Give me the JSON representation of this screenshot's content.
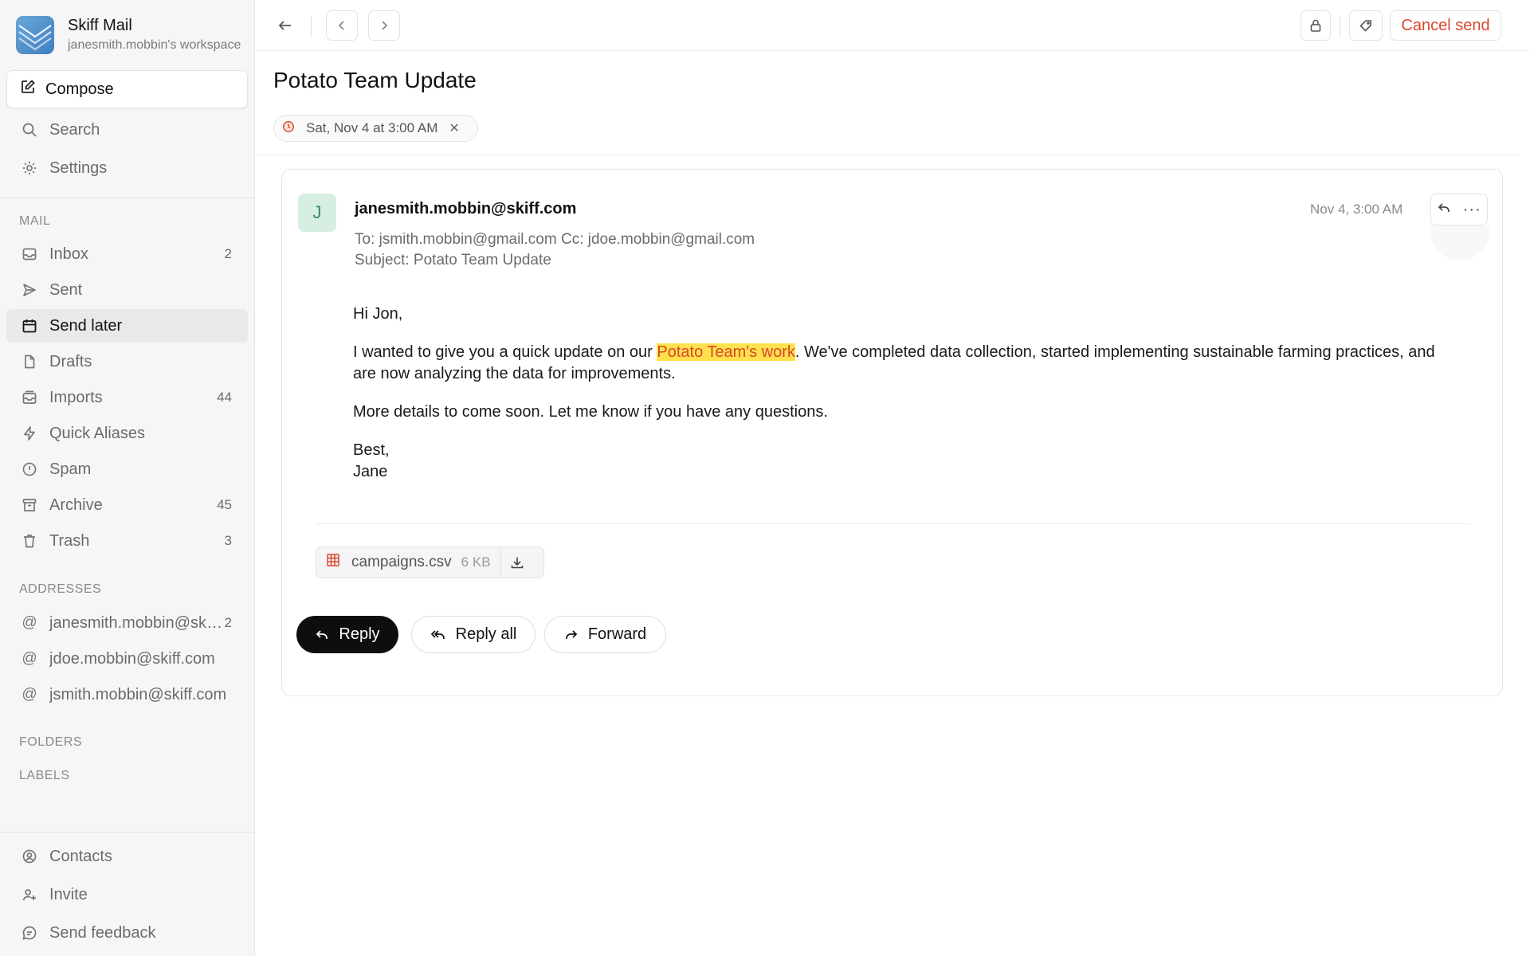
{
  "app": {
    "title": "Skiff Mail",
    "workspace": "janesmith.mobbin's workspace"
  },
  "sidebar": {
    "compose_label": "Compose",
    "search_label": "Search",
    "settings_label": "Settings",
    "mail_section": "MAIL",
    "mail_items": [
      {
        "label": "Inbox",
        "count": "2",
        "icon": "inbox-icon"
      },
      {
        "label": "Sent",
        "count": "",
        "icon": "send-icon"
      },
      {
        "label": "Send later",
        "count": "",
        "icon": "calendar-icon"
      },
      {
        "label": "Drafts",
        "count": "",
        "icon": "file-icon"
      },
      {
        "label": "Imports",
        "count": "44",
        "icon": "imports-icon"
      },
      {
        "label": "Quick Aliases",
        "count": "",
        "icon": "bolt-icon"
      },
      {
        "label": "Spam",
        "count": "",
        "icon": "alert-icon"
      },
      {
        "label": "Archive",
        "count": "45",
        "icon": "archive-icon"
      },
      {
        "label": "Trash",
        "count": "3",
        "icon": "trash-icon"
      }
    ],
    "active_item": "Send later",
    "addresses_section": "ADDRESSES",
    "addresses": [
      {
        "label": "janesmith.mobbin@skiff.com",
        "count": "2"
      },
      {
        "label": "jdoe.mobbin@skiff.com",
        "count": ""
      },
      {
        "label": "jsmith.mobbin@skiff.com",
        "count": ""
      }
    ],
    "folders_section": "FOLDERS",
    "labels_section": "LABELS",
    "footer_items": [
      {
        "label": "Contacts",
        "icon": "contacts-icon"
      },
      {
        "label": "Invite",
        "icon": "invite-icon"
      },
      {
        "label": "Send feedback",
        "icon": "feedback-icon"
      }
    ]
  },
  "toolbar": {
    "cancel_send_label": "Cancel send"
  },
  "email": {
    "subject": "Potato Team Update",
    "scheduled_for": "Sat, Nov 4 at 3:00 AM",
    "avatar_initial": "J",
    "from": "janesmith.mobbin@skiff.com",
    "date": "Nov 4, 3:00 AM",
    "to_line": "To: jsmith.mobbin@gmail.com Cc: jdoe.mobbin@gmail.com",
    "subject_line": "Subject: Potato Team Update",
    "greeting": "Hi Jon,",
    "para1_before": "I wanted to give you a quick update on our ",
    "para1_highlight": "Potato Team's work",
    "para1_after": ". We've completed data collection, started implementing sustainable farming practices, and are now analyzing the data for improvements.",
    "para2": "More details to come soon. Let me know if you have any questions.",
    "signoff": "Best,",
    "signature": "Jane",
    "attachment": {
      "name": "campaigns.csv",
      "size": "6 KB"
    },
    "highlight_colors": {
      "background": "#ffe14d",
      "text": "#d9472b"
    }
  },
  "actions": {
    "reply": "Reply",
    "reply_all": "Reply all",
    "forward": "Forward"
  },
  "colors": {
    "accent_red": "#d9472b",
    "primary_dark": "#0e0e0e",
    "sidebar_bg": "#f6f6f6"
  }
}
